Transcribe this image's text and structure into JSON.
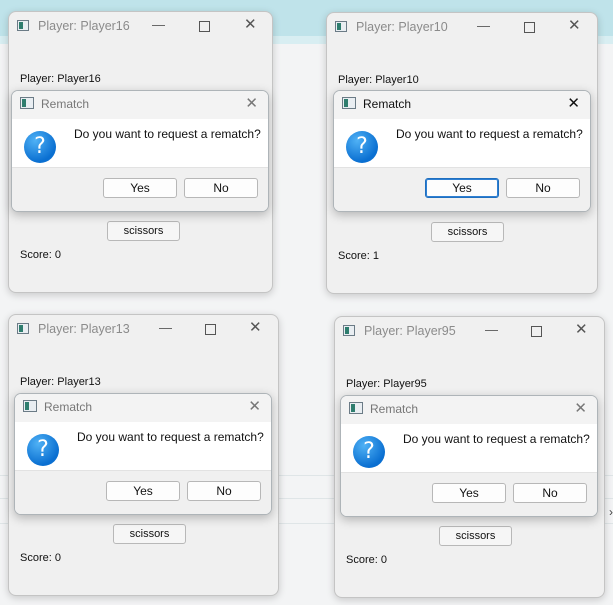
{
  "windows": [
    {
      "title": "Player: Player16",
      "player_label": "Player: Player16",
      "choice": "scissors",
      "score": "Score: 0",
      "dialog": {
        "title": "Rematch",
        "question": "Do you want to request a rematch?",
        "yes": "Yes",
        "no": "No"
      }
    },
    {
      "title": "Player: Player10",
      "player_label": "Player: Player10",
      "choice": "scissors",
      "score": "Score: 1",
      "dialog": {
        "title": "Rematch",
        "question": "Do you want to request a rematch?",
        "yes": "Yes",
        "no": "No"
      }
    },
    {
      "title": "Player: Player13",
      "player_label": "Player: Player13",
      "choice": "scissors",
      "score": "Score: 0",
      "dialog": {
        "title": "Rematch",
        "question": "Do you want to request a rematch?",
        "yes": "Yes",
        "no": "No"
      }
    },
    {
      "title": "Player: Player95",
      "player_label": "Player: Player95",
      "choice": "scissors",
      "score": "Score: 0",
      "dialog": {
        "title": "Rematch",
        "question": "Do you want to request a rematch?",
        "yes": "Yes",
        "no": "No"
      }
    }
  ],
  "icons": {
    "question": "question-icon",
    "app": "app-window-icon",
    "minimize": "minimize-icon",
    "maximize": "maximize-icon",
    "close": "close-icon"
  },
  "colors": {
    "accent": "#0a6fd1",
    "focus_border": "#1f6fbf",
    "window_bg": "#f0f0f0"
  }
}
